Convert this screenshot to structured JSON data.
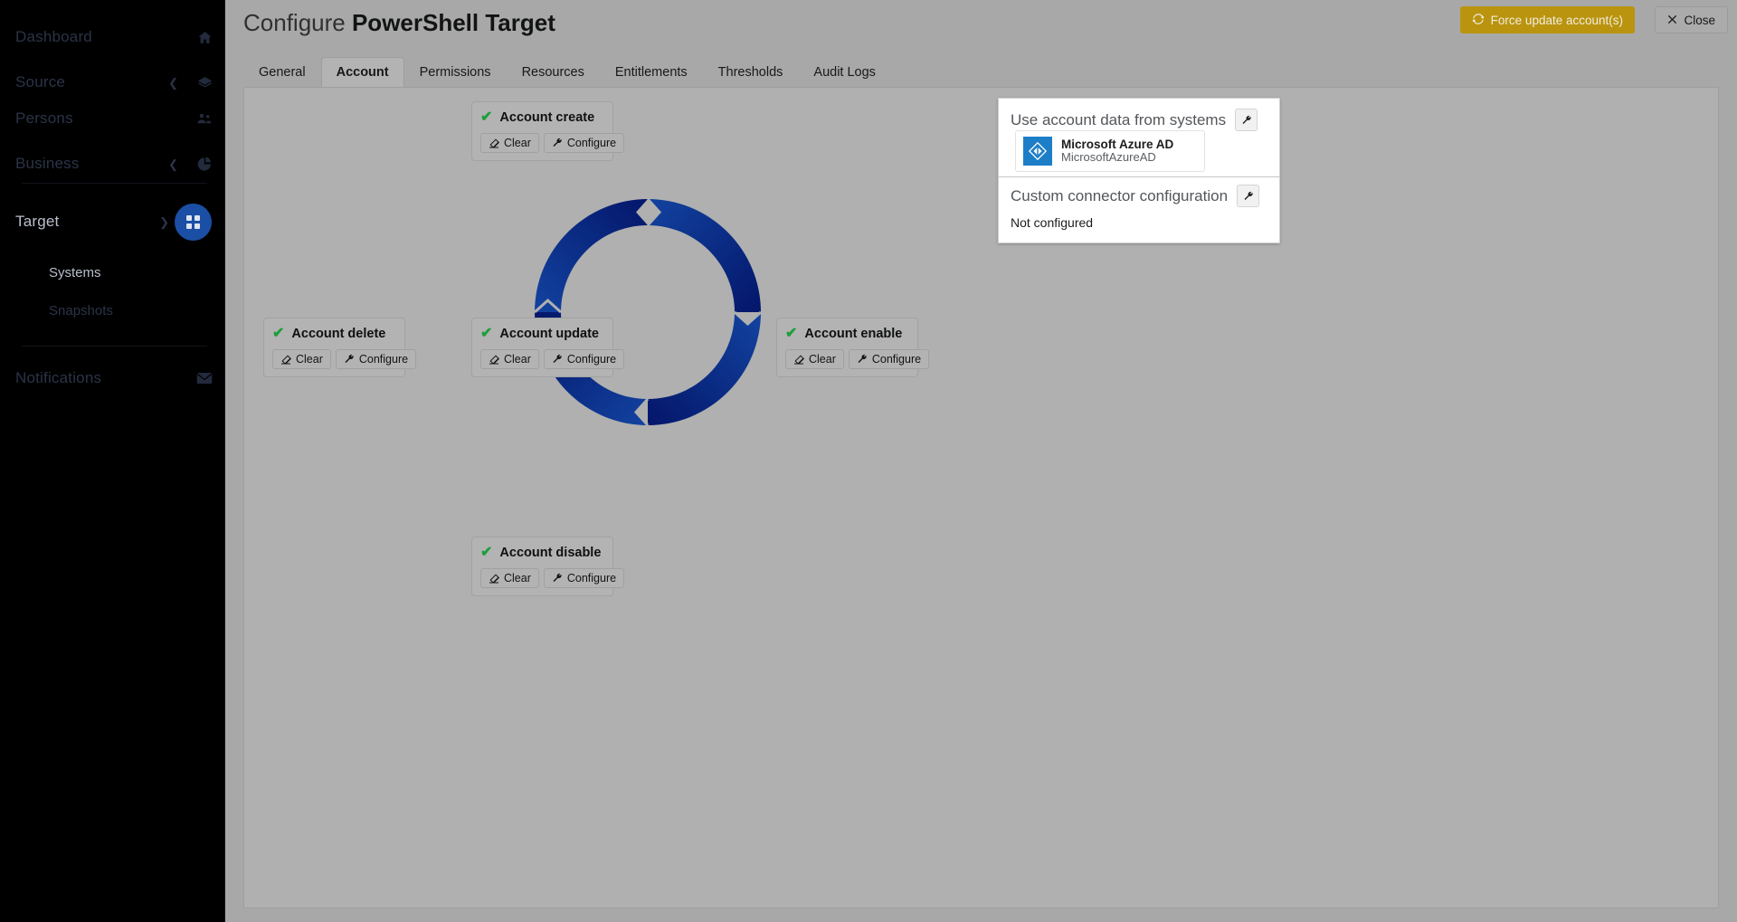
{
  "sidebar": {
    "items": [
      {
        "label": "Dashboard",
        "icon": "home-icon",
        "chevron": false,
        "active": false
      },
      {
        "label": "Source",
        "icon": "layers-icon",
        "chevron": true,
        "active": false
      },
      {
        "label": "Persons",
        "icon": "users-icon",
        "chevron": false,
        "active": false
      },
      {
        "label": "Business",
        "icon": "pie-icon",
        "chevron": true,
        "active": false
      },
      {
        "label": "Target",
        "icon": "grid-icon",
        "chevron": true,
        "active": true
      }
    ],
    "sub_items": [
      {
        "label": "Systems",
        "active": true
      },
      {
        "label": "Snapshots",
        "active": false
      }
    ],
    "notifications": {
      "label": "Notifications",
      "icon": "envelope-icon"
    }
  },
  "header": {
    "title_prefix": "Configure ",
    "title_bold": "PowerShell Target",
    "force_update_label": "Force update account(s)",
    "force_update_icon": "refresh-icon",
    "close_label": "Close",
    "close_icon": "close-icon",
    "accent_gold": "#ba940e"
  },
  "tabs": [
    {
      "label": "General",
      "selected": false
    },
    {
      "label": "Account",
      "selected": true
    },
    {
      "label": "Permissions",
      "selected": false
    },
    {
      "label": "Resources",
      "selected": false
    },
    {
      "label": "Entitlements",
      "selected": false
    },
    {
      "label": "Thresholds",
      "selected": false
    },
    {
      "label": "Audit Logs",
      "selected": false
    }
  ],
  "lifecycle": {
    "check_icon": "check-icon",
    "check_color": "#1e9e3d",
    "clear_label": "Clear",
    "clear_icon": "eraser-icon",
    "configure_label": "Configure",
    "configure_icon": "wrench-icon",
    "cards": [
      {
        "title": "Account create",
        "position": "top"
      },
      {
        "title": "Account delete",
        "position": "left"
      },
      {
        "title": "Account update",
        "position": "center"
      },
      {
        "title": "Account enable",
        "position": "right"
      },
      {
        "title": "Account disable",
        "position": "bottom"
      }
    ],
    "ring": {
      "segments": 4,
      "color_light": "#13449e",
      "color_dark": "#041a66",
      "gap_color": "#b0b0b0"
    }
  },
  "account_data": {
    "use_label": "Use account data from systems",
    "use_config_icon": "wrench-icon",
    "system": {
      "name": "Microsoft Azure AD",
      "identifier": "MicrosoftAzureAD",
      "logo": "azure-ad-logo",
      "logo_color": "#1d7ec8"
    },
    "custom_label": "Custom connector configuration",
    "custom_config_icon": "wrench-icon",
    "custom_status": "Not configured"
  }
}
